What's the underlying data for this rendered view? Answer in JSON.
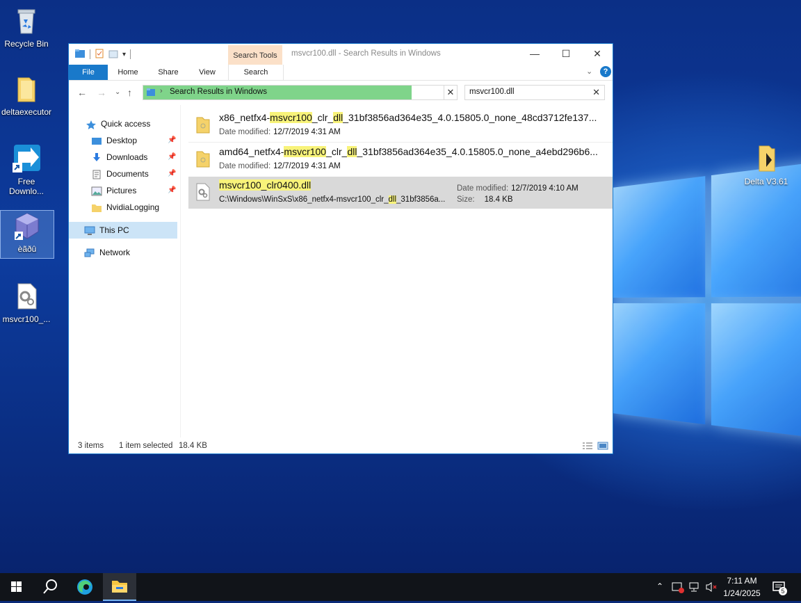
{
  "desktop": {
    "icons": [
      {
        "label": "Recycle Bin"
      },
      {
        "label": "deltaexecutor"
      },
      {
        "label": "Free Downlo..."
      },
      {
        "label": "èãðû"
      },
      {
        "label": "msvcr100_..."
      },
      {
        "label": "Delta V3.61"
      }
    ]
  },
  "window": {
    "title": "msvcr100.dll - Search Results in Windows",
    "context_tab": "Search Tools",
    "ribbon_tabs": [
      "File",
      "Home",
      "Share",
      "View",
      "Search"
    ],
    "address": "Search Results in Windows",
    "search_value": "msvcr100.dll",
    "nav": {
      "quick_access": "Quick access",
      "items": [
        "Desktop",
        "Downloads",
        "Documents",
        "Pictures",
        "NvidiaLogging"
      ],
      "this_pc": "This PC",
      "network": "Network"
    },
    "results": [
      {
        "name_pre": "x86_netfx4-",
        "name_hl1": "msvcr100",
        "name_mid": "_clr_",
        "name_hl2": "dll",
        "name_post": "_31bf3856ad364e35_4.0.15805.0_none_48cd3712fe137...",
        "meta_label": "Date modified:",
        "meta_value": "12/7/2019 4:31 AM"
      },
      {
        "name_pre": "amd64_netfx4-",
        "name_hl1": "msvcr100",
        "name_mid": "_clr_",
        "name_hl2": "dll",
        "name_post": "_31bf3856ad364e35_4.0.15805.0_none_a4ebd296b6...",
        "meta_label": "Date modified:",
        "meta_value": "12/7/2019 4:31 AM"
      },
      {
        "name_hl": "msvcr100_clr0400.dll",
        "path_pre": "C:\\Windows\\WinSxS\\x86_netfx4-msvcr100_clr_",
        "path_hl": "dll",
        "path_post": "_31bf3856a...",
        "date_label": "Date modified:",
        "date_value": "12/7/2019 4:10 AM",
        "size_label": "Size:",
        "size_value": "18.4 KB"
      }
    ],
    "status": {
      "items": "3 items",
      "selected": "1 item selected",
      "size": "18.4 KB"
    }
  },
  "taskbar": {
    "time": "7:11 AM",
    "date": "1/24/2025",
    "notifications": "5"
  },
  "colors": {
    "accent": "#1979ca",
    "search_tools": "#fbe0c8",
    "progress": "#7fd48a",
    "highlight": "#f8f37a"
  }
}
